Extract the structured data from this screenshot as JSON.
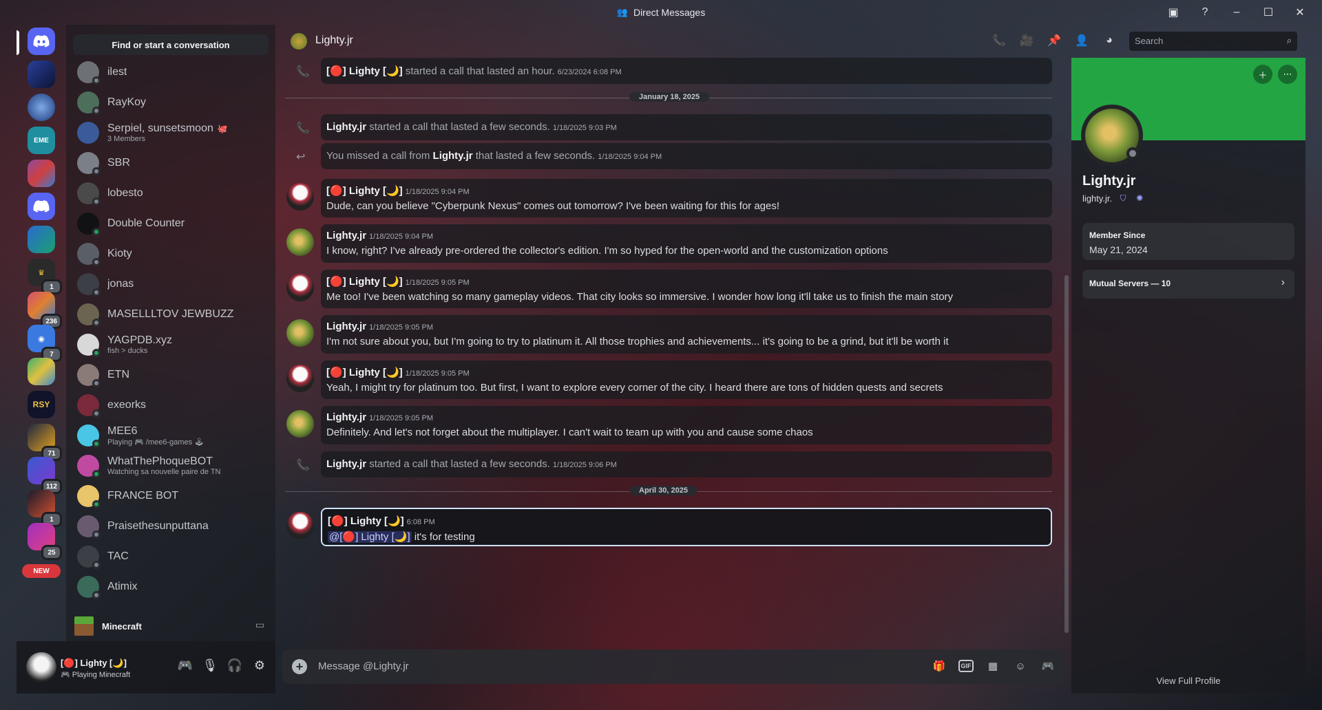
{
  "window": {
    "title": "Direct Messages"
  },
  "sidebar": {
    "find_label": "Find or start a conversation",
    "dms": [
      {
        "name": "ilest",
        "sub": "",
        "status": "offline",
        "color": "#6d7075"
      },
      {
        "name": "RayKoy",
        "sub": "",
        "status": "offline",
        "color": "#4d6e5a"
      },
      {
        "name": "Serpiel, sunsetsmoon",
        "sub": "3 Members",
        "status": "",
        "color": "#3a5a9a",
        "emoji": "🐙"
      },
      {
        "name": "SBR",
        "sub": "",
        "status": "offline",
        "color": "#7a7f88"
      },
      {
        "name": "lobesto",
        "sub": "",
        "status": "offline",
        "color": "#4a4a4a"
      },
      {
        "name": "Double Counter",
        "sub": "",
        "status": "online",
        "color": "#111214"
      },
      {
        "name": "Kioty",
        "sub": "",
        "status": "offline",
        "color": "#5a5e66"
      },
      {
        "name": "jonas",
        "sub": "",
        "status": "offline",
        "color": "#3c3f45"
      },
      {
        "name": "MASELLLTOV JEWBUZZ",
        "sub": "",
        "status": "offline",
        "color": "#6b6450"
      },
      {
        "name": "YAGPDB.xyz",
        "sub": "fish > ducks",
        "status": "online",
        "color": "#d8d8d8"
      },
      {
        "name": "ETN",
        "sub": "",
        "status": "offline",
        "color": "#8a7a78"
      },
      {
        "name": "exeorks",
        "sub": "",
        "status": "offline",
        "color": "#7a2a3a"
      },
      {
        "name": "MEE6",
        "sub": "Playing 🎮 /mee6-games 🕹",
        "status": "online",
        "color": "#49c6e5"
      },
      {
        "name": "WhatThePhoqueBOT",
        "sub": "Watching sa nouvelle paire de TN",
        "status": "online",
        "color": "#c04aa0"
      },
      {
        "name": "FRANCE BOT",
        "sub": "",
        "status": "online",
        "color": "#e8c46a"
      },
      {
        "name": "Praisethesunputtana",
        "sub": "",
        "status": "offline",
        "color": "#6a5a70"
      },
      {
        "name": "TAC",
        "sub": "",
        "status": "offline",
        "color": "#3c3f45"
      },
      {
        "name": "Atimix",
        "sub": "",
        "status": "offline",
        "color": "#3a6a5a"
      }
    ],
    "minecraft_label": "Minecraft"
  },
  "rail": {
    "badges": [
      "1",
      "236",
      "7",
      "71",
      "112",
      "1",
      "25"
    ],
    "new_label": "NEW"
  },
  "user_panel": {
    "name": "[🔴] Lighty [🌙]",
    "status": "Playing Minecraft"
  },
  "chat": {
    "recipient": "Lighty.jr",
    "search_placeholder": "Search",
    "composer_placeholder": "Message @Lighty.jr",
    "messages": [
      {
        "kind": "call",
        "author": "[🔴] Lighty [🌙]",
        "text": "started a call that lasted an hour.",
        "time": "6/23/2024 6:08 PM"
      },
      {
        "kind": "date",
        "label": "January 18, 2025"
      },
      {
        "kind": "call",
        "author": "Lighty.jr",
        "text": "started a call that lasted a few seconds.",
        "time": "1/18/2025 9:03 PM"
      },
      {
        "kind": "missed",
        "prefix": "You missed a call from",
        "author": "Lighty.jr",
        "text": "that lasted a few seconds.",
        "time": "1/18/2025 9:04 PM"
      },
      {
        "kind": "msg",
        "who": "lighty",
        "author": "[🔴] Lighty [🌙]",
        "time": "1/18/2025 9:04 PM",
        "text": "Dude, can you believe \"Cyberpunk Nexus\" comes out tomorrow? I've been waiting for this for ages!"
      },
      {
        "kind": "msg",
        "who": "jr",
        "author": "Lighty.jr",
        "time": "1/18/2025 9:04 PM",
        "text": "I know, right? I've already pre-ordered the collector's edition. I'm so hyped for the open-world and the customization options"
      },
      {
        "kind": "msg",
        "who": "lighty",
        "author": "[🔴] Lighty [🌙]",
        "time": "1/18/2025 9:05 PM",
        "text": "Me too! I've been watching so many gameplay videos. That city looks so immersive. I wonder how long it'll take us to finish the main story"
      },
      {
        "kind": "msg",
        "who": "jr",
        "author": "Lighty.jr",
        "time": "1/18/2025 9:05 PM",
        "text": "I'm not sure about you, but I'm going to try to platinum it. All those trophies and achievements... it's going to be a grind, but it'll be worth it"
      },
      {
        "kind": "msg",
        "who": "lighty",
        "author": "[🔴] Lighty [🌙]",
        "time": "1/18/2025 9:05 PM",
        "text": "Yeah, I might try for platinum too. But first, I want to explore every corner of the city. I heard there are tons of hidden quests and secrets"
      },
      {
        "kind": "msg",
        "who": "jr",
        "author": "Lighty.jr",
        "time": "1/18/2025 9:05 PM",
        "text": "Definitely. And let's not forget about the multiplayer. I can't wait to team up with you and cause some chaos"
      },
      {
        "kind": "call",
        "author": "Lighty.jr",
        "text": "started a call that lasted a few seconds.",
        "time": "1/18/2025 9:06 PM"
      },
      {
        "kind": "date",
        "label": "April 30, 2025"
      },
      {
        "kind": "msg",
        "who": "lighty",
        "author": "[🔴] Lighty [🌙]",
        "time": "6:08 PM",
        "mention": "@[🔴] Lighty [🌙]",
        "text": "it's for testing"
      }
    ]
  },
  "profile": {
    "display_name": "Lighty.jr",
    "username": "lighty.jr.",
    "member_since_label": "Member Since",
    "member_since": "May 21, 2024",
    "mutual_servers": "Mutual Servers — 10",
    "view_full": "View Full Profile",
    "banner_color": "#24a544"
  }
}
